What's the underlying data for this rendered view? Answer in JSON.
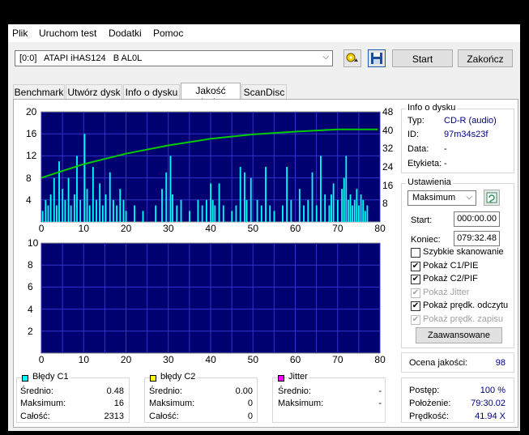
{
  "menu": {
    "items": [
      "Plik",
      "Uruchom test",
      "Dodatki",
      "Pomoc"
    ]
  },
  "toolbar": {
    "drive": "[0:0]   ATAPI iHAS124   B AL0L",
    "start": "Start",
    "close": "Zakończ"
  },
  "tabs": [
    "Benchmark",
    "Utwórz dysk",
    "Info o dysku",
    "Jakość dysku",
    "ScanDisc"
  ],
  "active_tab": 3,
  "chart_data": [
    {
      "type": "bar",
      "name": "C1",
      "x_range": [
        0,
        80
      ],
      "y_left_range": [
        0,
        20
      ],
      "y_right_range": [
        0,
        48
      ],
      "x_ticks": [
        "0",
        "10",
        "20",
        "30",
        "40",
        "50",
        "60",
        "70",
        "80"
      ],
      "y_ticks": [
        "20",
        "16",
        "12",
        "8",
        "4"
      ],
      "y_right_ticks": [
        "48",
        "40",
        "32",
        "24",
        "16",
        "8"
      ],
      "speed_line": [
        [
          0,
          8.0
        ],
        [
          10,
          10.5
        ],
        [
          20,
          12.4
        ],
        [
          30,
          13.9
        ],
        [
          40,
          15.1
        ],
        [
          50,
          15.9
        ],
        [
          60,
          16.4
        ],
        [
          70,
          16.8
        ],
        [
          75,
          16.8
        ],
        [
          79.5,
          16.8
        ]
      ],
      "bars": [
        [
          0.3,
          2
        ],
        [
          1,
          4
        ],
        [
          1.6,
          3
        ],
        [
          2.2,
          5
        ],
        [
          3.0,
          8
        ],
        [
          3.6,
          3
        ],
        [
          4.2,
          11
        ],
        [
          5.0,
          6
        ],
        [
          5.6,
          4
        ],
        [
          6.4,
          8
        ],
        [
          7.0,
          3
        ],
        [
          7.8,
          5
        ],
        [
          8.4,
          12
        ],
        [
          9.2,
          4
        ],
        [
          10.2,
          16
        ],
        [
          10.8,
          6
        ],
        [
          11.4,
          3
        ],
        [
          12.2,
          10
        ],
        [
          13.0,
          4
        ],
        [
          13.8,
          7
        ],
        [
          14.5,
          3
        ],
        [
          15.2,
          5
        ],
        [
          16.2,
          9
        ],
        [
          17,
          4
        ],
        [
          17.8,
          3
        ],
        [
          18.6,
          6
        ],
        [
          19.4,
          4
        ],
        [
          20,
          2
        ],
        [
          22,
          3
        ],
        [
          24,
          2
        ],
        [
          27,
          3
        ],
        [
          28.5,
          6
        ],
        [
          29.5,
          9
        ],
        [
          30.5,
          12
        ],
        [
          31,
          5
        ],
        [
          32,
          3
        ],
        [
          33,
          4
        ],
        [
          35,
          2
        ],
        [
          37,
          4
        ],
        [
          38,
          3
        ],
        [
          39,
          4
        ],
        [
          40,
          7
        ],
        [
          40.5,
          4
        ],
        [
          41,
          3
        ],
        [
          42,
          7
        ],
        [
          43,
          3
        ],
        [
          45,
          2
        ],
        [
          46,
          3
        ],
        [
          47,
          10
        ],
        [
          48,
          9
        ],
        [
          48.5,
          4
        ],
        [
          49.5,
          8
        ],
        [
          51,
          4
        ],
        [
          52,
          3
        ],
        [
          53,
          10
        ],
        [
          54,
          3
        ],
        [
          55,
          2
        ],
        [
          57,
          3
        ],
        [
          58,
          10
        ],
        [
          59,
          4
        ],
        [
          61,
          6
        ],
        [
          62,
          3
        ],
        [
          63,
          4
        ],
        [
          64,
          9
        ],
        [
          65,
          3
        ],
        [
          66,
          12
        ],
        [
          67,
          5
        ],
        [
          68,
          3
        ],
        [
          68.5,
          5
        ],
        [
          69,
          7
        ],
        [
          70,
          4
        ],
        [
          71,
          6
        ],
        [
          71.5,
          8
        ],
        [
          72,
          12
        ],
        [
          72.5,
          4
        ],
        [
          73,
          5
        ],
        [
          73.5,
          3
        ],
        [
          74,
          4
        ],
        [
          74.5,
          6
        ],
        [
          75,
          3
        ],
        [
          75.5,
          5
        ],
        [
          76,
          4
        ],
        [
          76.5,
          2
        ],
        [
          77,
          3
        ]
      ]
    },
    {
      "type": "bar",
      "name": "C2",
      "x_range": [
        0,
        80
      ],
      "y_range": [
        0,
        10
      ],
      "x_ticks": [
        "0",
        "10",
        "20",
        "30",
        "40",
        "50",
        "60",
        "70",
        "80"
      ],
      "y_ticks": [
        "10",
        "8",
        "6",
        "4",
        "2"
      ],
      "bars": []
    }
  ],
  "info": {
    "title": "Info o dysku",
    "type_label": "Typ:",
    "type_value": "CD-R (audio)",
    "id_label": "ID:",
    "id_value": "97m34s23f",
    "date_label": "Data:",
    "date_value": "-",
    "etykieta_label": "Etykieta:",
    "etykieta_value": "-"
  },
  "settings": {
    "title": "Ustawienia",
    "speed": "Maksimum",
    "start_label": "Start:",
    "start_value": "000:00.00",
    "end_label": "Koniec:",
    "end_value": "079:32.48",
    "checks": [
      {
        "label": "Szybkie skanowanie",
        "checked": false,
        "enabled": true
      },
      {
        "label": "Pokaż C1/PIE",
        "checked": true,
        "enabled": true
      },
      {
        "label": "Pokaż C2/PIF",
        "checked": true,
        "enabled": true
      },
      {
        "label": "Pokaż Jitter",
        "checked": true,
        "enabled": false
      },
      {
        "label": "Pokaż prędk. odczytu",
        "checked": true,
        "enabled": true
      },
      {
        "label": "Pokaż prędk. zapisu",
        "checked": true,
        "enabled": false
      }
    ],
    "advanced": "Zaawansowane"
  },
  "quality": {
    "label": "Ocena jakości:",
    "value": "98"
  },
  "progress": {
    "postep_label": "Postęp:",
    "postep_value": "100 %",
    "polozenie_label": "Położenie:",
    "polozenie_value": "79:30.02",
    "predkosc_label": "Prędkość:",
    "predkosc_value": "41.94 X"
  },
  "stats": {
    "c1": {
      "title": "Błędy C1",
      "color": "#00ffff",
      "avg_label": "Średnio:",
      "avg": "0.48",
      "max_label": "Maksimum:",
      "max": "16",
      "total_label": "Całość:",
      "total": "2313"
    },
    "c2": {
      "title": "błędy C2",
      "color": "#ffff00",
      "avg_label": "Średnio:",
      "avg": "0.00",
      "max_label": "Maksimum:",
      "max": "0",
      "total_label": "Całość:",
      "total": "0"
    },
    "jitter": {
      "title": "Jitter",
      "color": "#ff00ff",
      "avg_label": "Średnio:",
      "avg": "-",
      "max_label": "Maksimum:",
      "max": "-"
    }
  }
}
